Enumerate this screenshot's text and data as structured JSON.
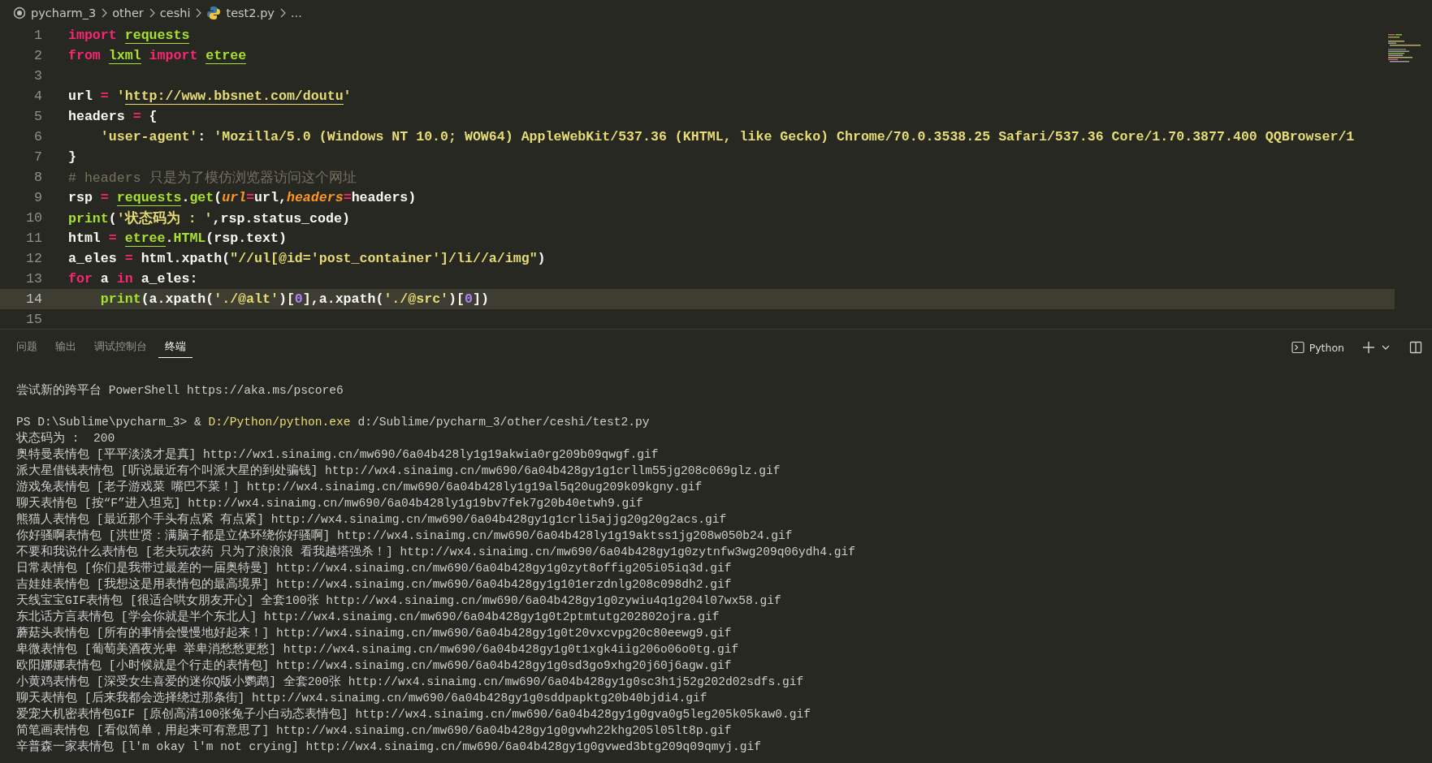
{
  "breadcrumb": {
    "items": [
      {
        "text": "pycharm_3",
        "kind": "folder"
      },
      {
        "text": "other",
        "kind": "folder"
      },
      {
        "text": "ceshi",
        "kind": "folder"
      },
      {
        "text": "test2.py",
        "kind": "python"
      },
      {
        "text": "...",
        "kind": "more"
      }
    ]
  },
  "editor": {
    "lines": [
      {
        "number": "1",
        "current": false,
        "tokens": [
          {
            "text": "import ",
            "kind": "keyword"
          },
          {
            "text": "requests",
            "kind": "module"
          }
        ]
      },
      {
        "number": "2",
        "current": false,
        "tokens": [
          {
            "text": "from ",
            "kind": "keyword"
          },
          {
            "text": "lxml",
            "kind": "module"
          },
          {
            "text": " import ",
            "kind": "keyword"
          },
          {
            "text": "etree",
            "kind": "module"
          }
        ]
      },
      {
        "number": "3",
        "current": false
      },
      {
        "number": "4",
        "current": false,
        "tokens": [
          {
            "text": "url ",
            "kind": "plain"
          },
          {
            "text": "= ",
            "kind": "operator"
          },
          {
            "text": "'",
            "kind": "string"
          },
          {
            "text": "http://www.bbsnet.com/doutu",
            "kind": "link"
          },
          {
            "text": "'",
            "kind": "string"
          }
        ]
      },
      {
        "number": "5",
        "current": false,
        "tokens": [
          {
            "text": "headers ",
            "kind": "plain"
          },
          {
            "text": "= ",
            "kind": "operator"
          },
          {
            "text": "{",
            "kind": "plain"
          }
        ]
      },
      {
        "number": "6",
        "current": false,
        "tokens": [
          {
            "text": "    'user-agent'",
            "kind": "string"
          },
          {
            "text": ": ",
            "kind": "plain"
          },
          {
            "text": "'Mozilla/5.0 (Windows NT 10.0; WOW64) AppleWebKit/537.36 (KHTML, like Gecko) Chrome/70.0.3538.25 Safari/537.36 Core/1.70.3877.400 QQBrowser/1",
            "kind": "string"
          }
        ]
      },
      {
        "number": "7",
        "current": false,
        "tokens": [
          {
            "text": "}",
            "kind": "plain"
          }
        ]
      },
      {
        "number": "8",
        "current": false,
        "tokens": [
          {
            "text": "# headers 只是为了模仿浏览器访问这个网址",
            "kind": "comment"
          }
        ]
      },
      {
        "number": "9",
        "current": false,
        "tokens": [
          {
            "text": "rsp ",
            "kind": "plain"
          },
          {
            "text": "= ",
            "kind": "operator"
          },
          {
            "text": "requests",
            "kind": "module"
          },
          {
            "text": ".",
            "kind": "plain"
          },
          {
            "text": "get",
            "kind": "function"
          },
          {
            "text": "(",
            "kind": "plain"
          },
          {
            "text": "url",
            "kind": "parameter"
          },
          {
            "text": "=",
            "kind": "operator"
          },
          {
            "text": "url,",
            "kind": "plain"
          },
          {
            "text": "headers",
            "kind": "parameter"
          },
          {
            "text": "=",
            "kind": "operator"
          },
          {
            "text": "headers)",
            "kind": "plain"
          }
        ]
      },
      {
        "number": "10",
        "current": false,
        "tokens": [
          {
            "text": "print",
            "kind": "function"
          },
          {
            "text": "(",
            "kind": "plain"
          },
          {
            "text": "'状态码为 : '",
            "kind": "string"
          },
          {
            "text": ",rsp.status_code)",
            "kind": "plain"
          }
        ]
      },
      {
        "number": "11",
        "current": false,
        "tokens": [
          {
            "text": "html ",
            "kind": "plain"
          },
          {
            "text": "= ",
            "kind": "operator"
          },
          {
            "text": "etree",
            "kind": "module"
          },
          {
            "text": ".",
            "kind": "plain"
          },
          {
            "text": "HTML",
            "kind": "function"
          },
          {
            "text": "(rsp.text)",
            "kind": "plain"
          }
        ]
      },
      {
        "number": "12",
        "current": false,
        "tokens": [
          {
            "text": "a_eles ",
            "kind": "plain"
          },
          {
            "text": "= ",
            "kind": "operator"
          },
          {
            "text": "html.xpath(",
            "kind": "plain"
          },
          {
            "text": "\"//ul[@id='post_container']/li//a/img\"",
            "kind": "string"
          },
          {
            "text": ")",
            "kind": "plain"
          }
        ]
      },
      {
        "number": "13",
        "current": false,
        "tokens": [
          {
            "text": "for ",
            "kind": "keyword"
          },
          {
            "text": "a ",
            "kind": "plain"
          },
          {
            "text": "in ",
            "kind": "keyword"
          },
          {
            "text": "a_eles:",
            "kind": "plain"
          }
        ]
      },
      {
        "number": "14",
        "current": true,
        "tokens": [
          {
            "text": "    print",
            "kind": "function"
          },
          {
            "text": "(a.xpath(",
            "kind": "plain"
          },
          {
            "text": "'./@alt'",
            "kind": "string"
          },
          {
            "text": ")[",
            "kind": "plain"
          },
          {
            "text": "0",
            "kind": "number"
          },
          {
            "text": "],a.xpath(",
            "kind": "plain"
          },
          {
            "text": "'./@src'",
            "kind": "string"
          },
          {
            "text": ")[",
            "kind": "plain"
          },
          {
            "text": "0",
            "kind": "number"
          },
          {
            "text": "])",
            "kind": "plain"
          }
        ]
      },
      {
        "number": "15",
        "current": false
      }
    ]
  },
  "panel": {
    "tabs": [
      {
        "label": "问题",
        "selected": false
      },
      {
        "label": "输出",
        "selected": false
      },
      {
        "label": "调试控制台",
        "selected": false
      },
      {
        "label": "终端",
        "selected": true
      }
    ],
    "shell": "Python"
  },
  "terminal": {
    "banner": "尝试新的跨平台 PowerShell https://aka.ms/pscore6",
    "command": {
      "prompt": "PS D:\\Sublime\\pycharm_3> & ",
      "program": "D:/Python/python.exe",
      "args": " d:/Sublime/pycharm_3/other/ceshi/test2.py"
    },
    "output": [
      "状态码为 :  200",
      "奥特曼表情包 [平平淡淡才是真] http://wx1.sinaimg.cn/mw690/6a04b428ly1g19akwia0rg209b09qwgf.gif",
      "派大星借钱表情包 [听说最近有个叫派大星的到处骗钱] http://wx4.sinaimg.cn/mw690/6a04b428gy1g1crllm55jg208c069glz.gif",
      "游戏兔表情包 [老子游戏菜 嘴巴不菜！] http://wx4.sinaimg.cn/mw690/6a04b428ly1g19al5q20ug209k09kgny.gif",
      "聊天表情包 [按“F”进入坦克] http://wx4.sinaimg.cn/mw690/6a04b428ly1g19bv7fek7g20b40etwh9.gif",
      "熊猫人表情包 [最近那个手头有点紧 有点紧] http://wx4.sinaimg.cn/mw690/6a04b428gy1g1crli5ajjg20g20g2acs.gif",
      "你好骚啊表情包 [洪世贤：满脑子都是立体环绕你好骚啊] http://wx4.sinaimg.cn/mw690/6a04b428ly1g19aktss1jg208w050b24.gif",
      "不要和我说什么表情包 [老夫玩农药 只为了浪浪浪 看我越塔强杀！] http://wx4.sinaimg.cn/mw690/6a04b428gy1g0zytnfw3wg209q06ydh4.gif",
      "日常表情包 [你们是我带过最差的一届奥特曼] http://wx4.sinaimg.cn/mw690/6a04b428gy1g0zyt8offig205i05iq3d.gif",
      "吉娃娃表情包 [我想这是用表情包的最高境界] http://wx4.sinaimg.cn/mw690/6a04b428gy1g101erzdnlg208c098dh2.gif",
      "天线宝宝GIF表情包 [很适合哄女朋友开心] 全套100张 http://wx4.sinaimg.cn/mw690/6a04b428gy1g0zywiu4q1g204l07wx58.gif",
      "东北话方言表情包 [学会你就是半个东北人] http://wx4.sinaimg.cn/mw690/6a04b428gy1g0t2ptmtutg202802ojra.gif",
      "蘑菇头表情包 [所有的事情会慢慢地好起来！] http://wx4.sinaimg.cn/mw690/6a04b428gy1g0t20vxcvpg20c80eewg9.gif",
      "卑微表情包 [葡萄美酒夜光卑 举卑消愁愁更愁] http://wx4.sinaimg.cn/mw690/6a04b428gy1g0t1xgk4iig206o06o0tg.gif",
      "欧阳娜娜表情包 [小时候就是个行走的表情包] http://wx4.sinaimg.cn/mw690/6a04b428gy1g0sd3go9xhg20j60j6agw.gif",
      "小黄鸡表情包 [深受女生喜爱的迷你Q版小鹦鹉] 全套200张 http://wx4.sinaimg.cn/mw690/6a04b428gy1g0sc3h1j52g202d02sdfs.gif",
      "聊天表情包 [后来我都会选择绕过那条街] http://wx4.sinaimg.cn/mw690/6a04b428gy1g0sddpapktg20b40bjdi4.gif",
      "爱宠大机密表情包GIF [原创高清100张兔子小白动态表情包] http://wx4.sinaimg.cn/mw690/6a04b428gy1g0gva0g5leg205k05kaw0.gif",
      "简笔画表情包 [看似简单，用起来可有意思了] http://wx4.sinaimg.cn/mw690/6a04b428gy1g0gvwh22khg205l05lt8p.gif",
      "辛普森一家表情包 [l'm okay l'm not crying] http://wx4.sinaimg.cn/mw690/6a04b428gy1g0gvwed3btg209q09qmyj.gif"
    ]
  }
}
